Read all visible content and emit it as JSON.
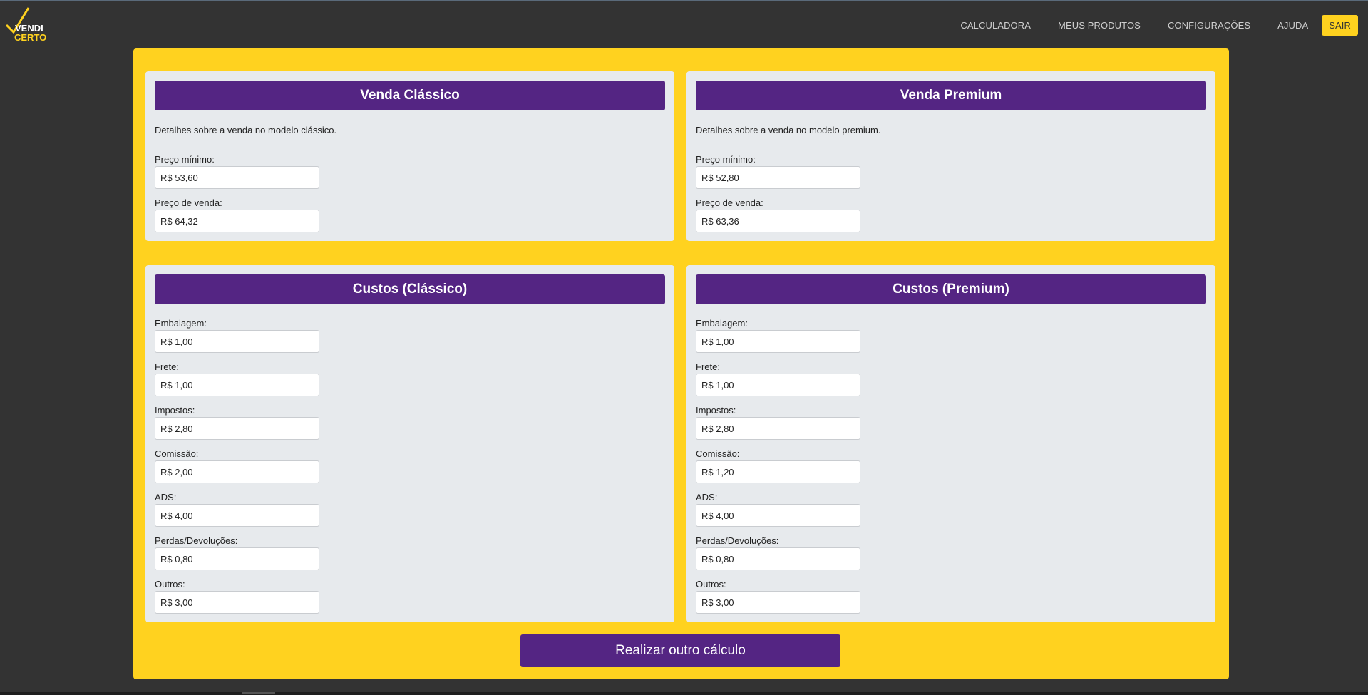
{
  "logo": {
    "line1": "VENDI",
    "line2": "CERTO"
  },
  "nav": {
    "items": [
      "CALCULADORA",
      "MEUS PRODUTOS",
      "CONFIGURAÇÕES",
      "AJUDA"
    ],
    "logout": "SAIR"
  },
  "venda_classico": {
    "title": "Venda Clássico",
    "description": "Detalhes sobre a venda no modelo clássico.",
    "min_price_label": "Preço mínimo:",
    "min_price": "R$ 53,60",
    "sale_price_label": "Preço de venda:",
    "sale_price": "R$ 64,32"
  },
  "venda_premium": {
    "title": "Venda Premium",
    "description": "Detalhes sobre a venda no modelo premium.",
    "min_price_label": "Preço mínimo:",
    "min_price": "R$ 52,80",
    "sale_price_label": "Preço de venda:",
    "sale_price": "R$ 63,36"
  },
  "custos_classico": {
    "title": "Custos (Clássico)",
    "fields": [
      {
        "label": "Embalagem:",
        "value": "R$ 1,00"
      },
      {
        "label": "Frete:",
        "value": "R$ 1,00"
      },
      {
        "label": "Impostos:",
        "value": "R$ 2,80"
      },
      {
        "label": "Comissão:",
        "value": "R$ 2,00"
      },
      {
        "label": "ADS:",
        "value": "R$ 4,00"
      },
      {
        "label": "Perdas/Devoluções:",
        "value": "R$ 0,80"
      },
      {
        "label": "Outros:",
        "value": "R$ 3,00"
      }
    ]
  },
  "custos_premium": {
    "title": "Custos (Premium)",
    "fields": [
      {
        "label": "Embalagem:",
        "value": "R$ 1,00"
      },
      {
        "label": "Frete:",
        "value": "R$ 1,00"
      },
      {
        "label": "Impostos:",
        "value": "R$ 2,80"
      },
      {
        "label": "Comissão:",
        "value": "R$ 1,20"
      },
      {
        "label": "ADS:",
        "value": "R$ 4,00"
      },
      {
        "label": "Perdas/Devoluções:",
        "value": "R$ 0,80"
      },
      {
        "label": "Outros:",
        "value": "R$ 3,00"
      }
    ]
  },
  "recalc_button": "Realizar outro cálculo",
  "colors": {
    "background": "#333333",
    "accent_yellow": "#ffd21f",
    "header_purple": "#542583",
    "card_gray": "#e7eaed"
  }
}
